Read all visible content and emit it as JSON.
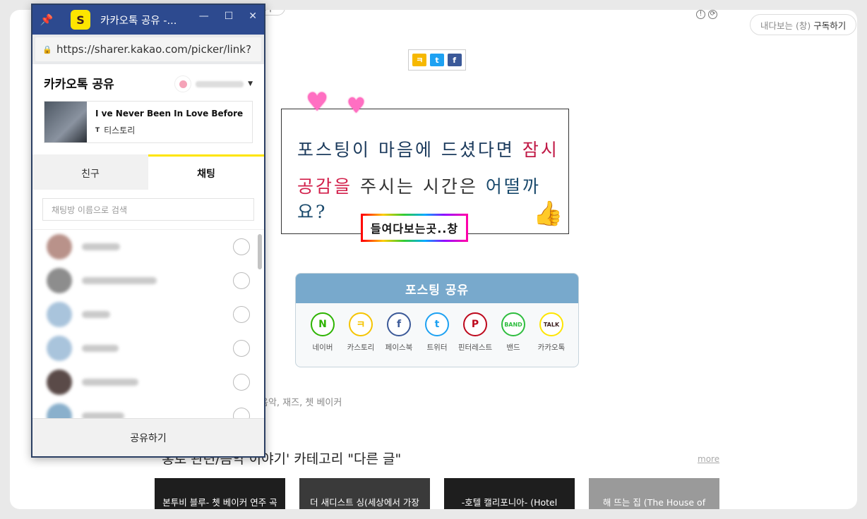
{
  "page": {
    "topbar_button": "하기",
    "subscribe_dim": "내다보는 (창)",
    "subscribe_label": "구독하기",
    "mini_share": [
      "ㅋ",
      "t",
      "f"
    ],
    "banner": {
      "line1_a": "포스팅이 마음에 드셨다면 ",
      "line1_b": "잠시",
      "line2_a": "공감을",
      "line2_b": " 주시는 시간은 ",
      "line2_c": "어떨까요?",
      "peek": "들여다보는곳..창"
    },
    "posting_share": {
      "title": "포스팅 공유",
      "items": [
        {
          "label": "네이버",
          "glyph": "N",
          "color": "#2db400"
        },
        {
          "label": "카스토리",
          "glyph": "ㅋ",
          "color": "#f5c400"
        },
        {
          "label": "페이스북",
          "glyph": "f",
          "color": "#3b5998"
        },
        {
          "label": "트위터",
          "glyph": "t",
          "color": "#1da1f2"
        },
        {
          "label": "핀터레스트",
          "glyph": "P",
          "color": "#bd081c"
        },
        {
          "label": "밴드",
          "glyph": "BAND",
          "color": "#2ebd3e"
        },
        {
          "label": "카카오톡",
          "glyph": "TALK",
          "color": "#fee500"
        }
      ]
    },
    "tags": "음악, 재즈, 쳇 베이커",
    "category_title": "'홍로 관련/음악 이야기' 카테고리 \"다른 글\"",
    "more": "more",
    "cards": [
      "본투비 블루- 쳇 베이커 연주 곡 모음",
      "더 새디스트 싱(세상에서 가장 슬픈 일)- Melanie",
      "-호텔 캘리포니아- (Hotel California - Eagles : 가사",
      "해 뜨는 집 (The House of the Rising Sun-Animals)"
    ]
  },
  "popup": {
    "window_title": "카카오톡 공유 -...",
    "app_logo": "S",
    "url": "https://sharer.kakao.com/picker/link?",
    "title": "카카오톡 공유",
    "link_title": "I ve Never Been In Love Before - ⋯",
    "link_source": "티스토리",
    "tabs": [
      "친구",
      "채팅"
    ],
    "active_tab": "채팅",
    "search_placeholder": "채팅방 이름으로 검색",
    "share_button": "공유하기"
  }
}
